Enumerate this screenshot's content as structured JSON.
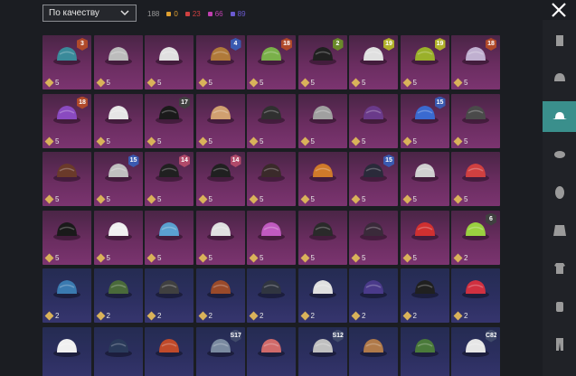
{
  "header": {
    "sort_label": "По качеству",
    "counts": [
      {
        "value": "188",
        "color": "#9a9a9a"
      },
      {
        "value": "0",
        "color": "#e0a030"
      },
      {
        "value": "23",
        "color": "#d04040"
      },
      {
        "value": "66",
        "color": "#c040b0"
      },
      {
        "value": "89",
        "color": "#6a5ad0"
      }
    ]
  },
  "colors": {
    "accent": "#3a8f8c",
    "tier_purple": "#6a2d60",
    "tier_blue": "#2c2f60",
    "diamond": "#d9b25a"
  },
  "grid": {
    "items": [
      {
        "qty": "5",
        "tier": "purple",
        "badge": "3",
        "badge_color": "#b04a2a",
        "hat": "#3a8a9a"
      },
      {
        "qty": "5",
        "tier": "purple",
        "badge": "",
        "badge_color": "",
        "hat": "#bcbcbc"
      },
      {
        "qty": "5",
        "tier": "purple",
        "badge": "",
        "badge_color": "",
        "hat": "#e0e0e0"
      },
      {
        "qty": "5",
        "tier": "purple",
        "badge": "4",
        "badge_color": "#3a5ab0",
        "hat": "#b07a3a"
      },
      {
        "qty": "5",
        "tier": "purple",
        "badge": "18",
        "badge_color": "#b04a2a",
        "hat": "#7ab04a"
      },
      {
        "qty": "5",
        "tier": "purple",
        "badge": "2",
        "badge_color": "#6a8a2a",
        "hat": "#202020"
      },
      {
        "qty": "5",
        "tier": "purple",
        "badge": "19",
        "badge_color": "#b0b02a",
        "hat": "#e0e0e0"
      },
      {
        "qty": "5",
        "tier": "purple",
        "badge": "19",
        "badge_color": "#b0b02a",
        "hat": "#9ab02a"
      },
      {
        "qty": "5",
        "tier": "purple",
        "badge": "18",
        "badge_color": "#b04a2a",
        "hat": "#c0b0d0"
      },
      {
        "qty": "5",
        "tier": "purple",
        "badge": "18",
        "badge_color": "#b04a2a",
        "hat": "#8a4ac0"
      },
      {
        "qty": "5",
        "tier": "purple",
        "badge": "",
        "badge_color": "",
        "hat": "#e6e6e6"
      },
      {
        "qty": "5",
        "tier": "purple",
        "badge": "17",
        "badge_color": "#404040",
        "hat": "#1a1a1a"
      },
      {
        "qty": "5",
        "tier": "purple",
        "badge": "",
        "badge_color": "",
        "hat": "#d0a070"
      },
      {
        "qty": "5",
        "tier": "purple",
        "badge": "",
        "badge_color": "",
        "hat": "#303030"
      },
      {
        "qty": "5",
        "tier": "purple",
        "badge": "",
        "badge_color": "",
        "hat": "#a0a0a0"
      },
      {
        "qty": "5",
        "tier": "purple",
        "badge": "",
        "badge_color": "",
        "hat": "#6a3a8a"
      },
      {
        "qty": "5",
        "tier": "purple",
        "badge": "15",
        "badge_color": "#3a5ab0",
        "hat": "#3a6ad0"
      },
      {
        "qty": "5",
        "tier": "purple",
        "badge": "",
        "badge_color": "",
        "hat": "#4a4a4a"
      },
      {
        "qty": "5",
        "tier": "purple",
        "badge": "",
        "badge_color": "",
        "hat": "#6a3a2a"
      },
      {
        "qty": "5",
        "tier": "purple",
        "badge": "15",
        "badge_color": "#3a5ab0",
        "hat": "#c0c0c0"
      },
      {
        "qty": "5",
        "tier": "purple",
        "badge": "14",
        "badge_color": "#b04a6a",
        "hat": "#202020"
      },
      {
        "qty": "5",
        "tier": "purple",
        "badge": "14",
        "badge_color": "#b04a6a",
        "hat": "#202020"
      },
      {
        "qty": "5",
        "tier": "purple",
        "badge": "",
        "badge_color": "",
        "hat": "#3a2a2a"
      },
      {
        "qty": "5",
        "tier": "purple",
        "badge": "",
        "badge_color": "",
        "hat": "#d07a2a"
      },
      {
        "qty": "5",
        "tier": "purple",
        "badge": "15",
        "badge_color": "#3a5ab0",
        "hat": "#2a2a3a"
      },
      {
        "qty": "5",
        "tier": "purple",
        "badge": "",
        "badge_color": "",
        "hat": "#d0d0d0"
      },
      {
        "qty": "5",
        "tier": "purple",
        "badge": "",
        "badge_color": "",
        "hat": "#d04040"
      },
      {
        "qty": "5",
        "tier": "purple",
        "badge": "",
        "badge_color": "",
        "hat": "#1a1a1a"
      },
      {
        "qty": "5",
        "tier": "purple",
        "badge": "",
        "badge_color": "",
        "hat": "#f0f0f0"
      },
      {
        "qty": "5",
        "tier": "purple",
        "badge": "",
        "badge_color": "",
        "hat": "#5aa0d0"
      },
      {
        "qty": "5",
        "tier": "purple",
        "badge": "",
        "badge_color": "",
        "hat": "#e0e0e0"
      },
      {
        "qty": "5",
        "tier": "purple",
        "badge": "",
        "badge_color": "",
        "hat": "#c05ac0"
      },
      {
        "qty": "5",
        "tier": "purple",
        "badge": "",
        "badge_color": "",
        "hat": "#2a2a2a"
      },
      {
        "qty": "5",
        "tier": "purple",
        "badge": "",
        "badge_color": "",
        "hat": "#3a2a3a"
      },
      {
        "qty": "5",
        "tier": "purple",
        "badge": "",
        "badge_color": "",
        "hat": "#d03030"
      },
      {
        "qty": "2",
        "tier": "purple",
        "badge": "6",
        "badge_color": "#404040",
        "hat": "#9ad040"
      },
      {
        "qty": "2",
        "tier": "blue",
        "badge": "",
        "badge_color": "",
        "hat": "#3a7ab0"
      },
      {
        "qty": "2",
        "tier": "blue",
        "badge": "",
        "badge_color": "",
        "hat": "#4a6a3a"
      },
      {
        "qty": "2",
        "tier": "blue",
        "badge": "",
        "badge_color": "",
        "hat": "#404040"
      },
      {
        "qty": "2",
        "tier": "blue",
        "badge": "",
        "badge_color": "",
        "hat": "#9a4a2a"
      },
      {
        "qty": "2",
        "tier": "blue",
        "badge": "",
        "badge_color": "",
        "hat": "#303540"
      },
      {
        "qty": "2",
        "tier": "blue",
        "badge": "",
        "badge_color": "",
        "hat": "#e0e0e0"
      },
      {
        "qty": "2",
        "tier": "blue",
        "badge": "",
        "badge_color": "",
        "hat": "#4a3a8a"
      },
      {
        "qty": "2",
        "tier": "blue",
        "badge": "",
        "badge_color": "",
        "hat": "#202020"
      },
      {
        "qty": "2",
        "tier": "blue",
        "badge": "",
        "badge_color": "",
        "hat": "#d03040"
      },
      {
        "qty": "",
        "tier": "blue",
        "badge": "",
        "badge_color": "",
        "hat": "#f0f0f0"
      },
      {
        "qty": "",
        "tier": "blue",
        "badge": "",
        "badge_color": "",
        "hat": "#2a3a5a"
      },
      {
        "qty": "",
        "tier": "blue",
        "badge": "",
        "badge_color": "",
        "hat": "#c04a2a"
      },
      {
        "qty": "",
        "tier": "blue",
        "badge": "S17",
        "badge_color": "#404a6a",
        "hat": "#7a8aa0"
      },
      {
        "qty": "",
        "tier": "blue",
        "badge": "",
        "badge_color": "",
        "hat": "#d06a6a"
      },
      {
        "qty": "",
        "tier": "blue",
        "badge": "S12",
        "badge_color": "#404a6a",
        "hat": "#c0c0c0"
      },
      {
        "qty": "",
        "tier": "blue",
        "badge": "",
        "badge_color": "",
        "hat": "#b07a4a"
      },
      {
        "qty": "",
        "tier": "blue",
        "badge": "",
        "badge_color": "",
        "hat": "#4a7a3a"
      },
      {
        "qty": "",
        "tier": "blue",
        "badge": "C8Z",
        "badge_color": "#404a6a",
        "hat": "#e6e6e6"
      }
    ]
  },
  "sidebar": {
    "items": [
      {
        "name": "outfit-icon",
        "active": false
      },
      {
        "name": "helmet-icon",
        "active": false
      },
      {
        "name": "hat-icon",
        "active": true
      },
      {
        "name": "mask-icon",
        "active": false
      },
      {
        "name": "face-icon",
        "active": false
      },
      {
        "name": "jacket-icon",
        "active": false
      },
      {
        "name": "shirt-icon",
        "active": false
      },
      {
        "name": "gloves-icon",
        "active": false
      },
      {
        "name": "pants-icon",
        "active": false
      }
    ]
  }
}
